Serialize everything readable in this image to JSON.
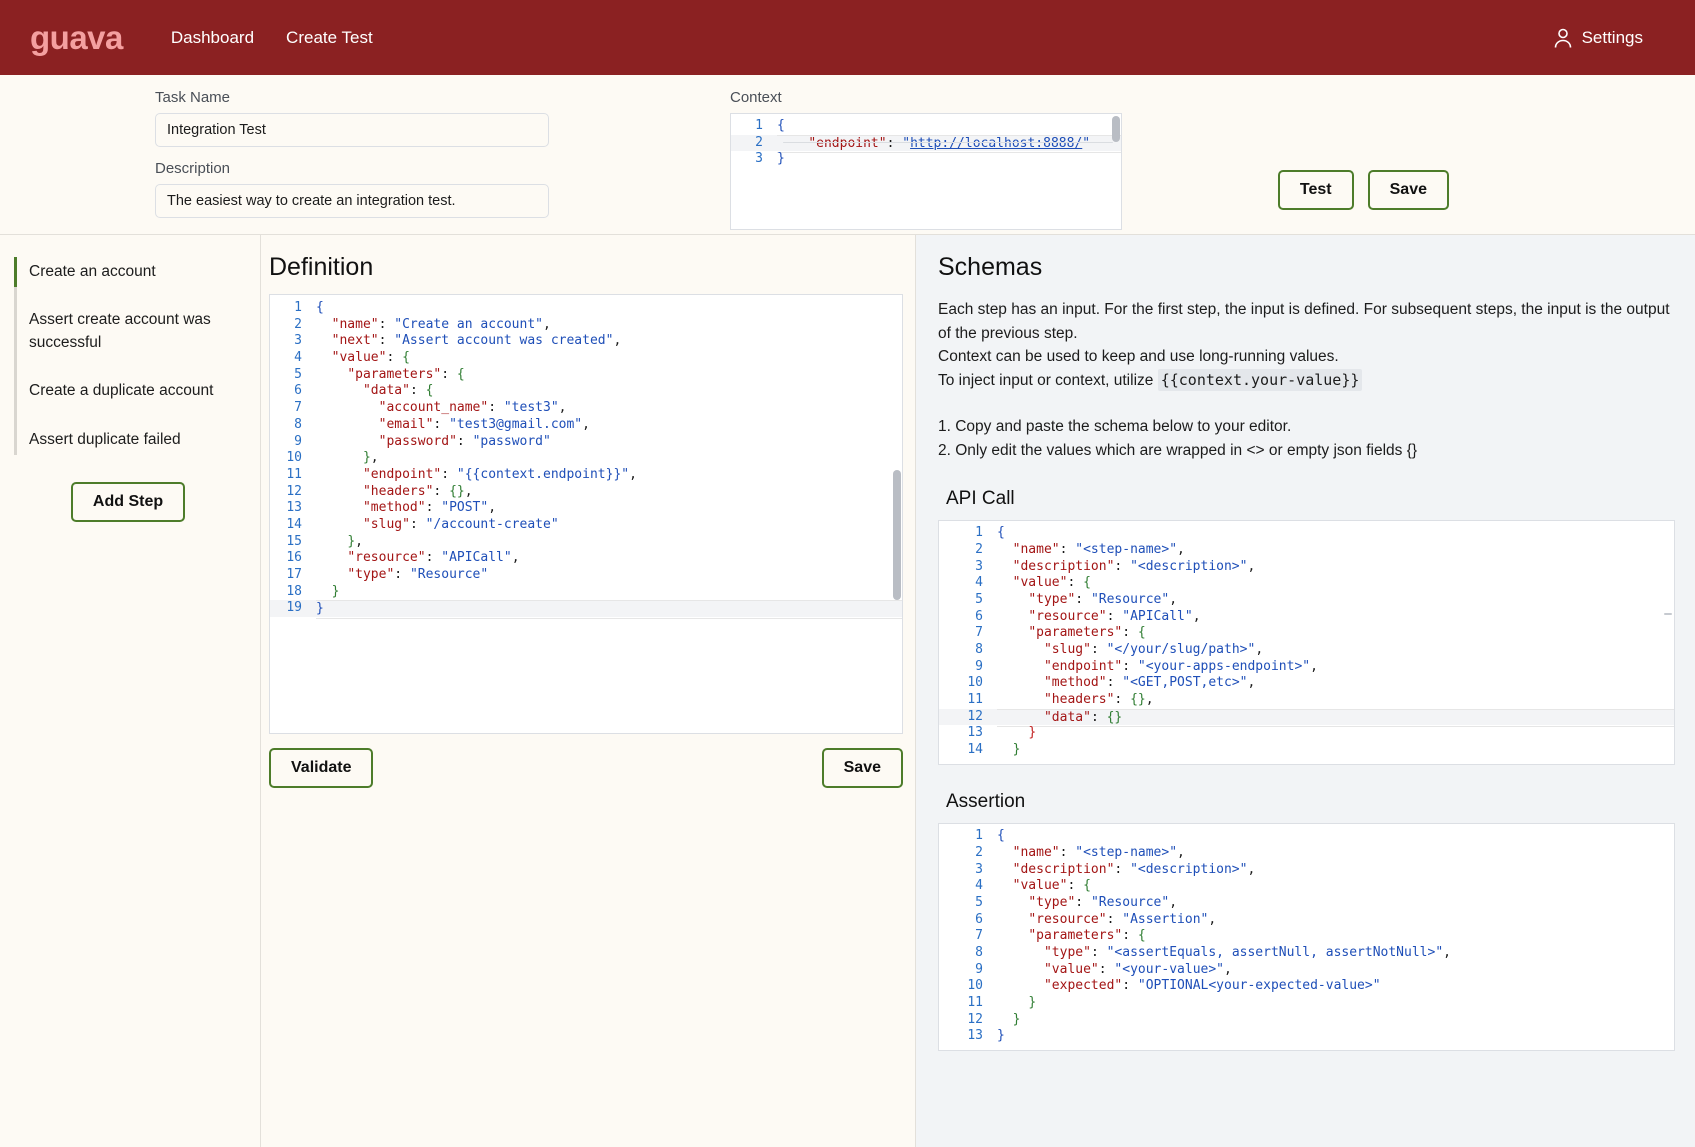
{
  "header": {
    "brand": "guava",
    "nav": [
      {
        "label": "Dashboard",
        "name": "nav-dashboard"
      },
      {
        "label": "Create Test",
        "name": "nav-create-test"
      }
    ],
    "settings_label": "Settings",
    "settings_icon": "person-icon",
    "bg_color": "#8b2122",
    "brand_color": "#f4a0a0"
  },
  "form": {
    "task_name_label": "Task Name",
    "task_name_value": "Integration Test",
    "task_name_placeholder": "Task Name",
    "description_label": "Description",
    "description_value": "The easiest way to create an integration test.",
    "description_placeholder": "Description",
    "context_label": "Context",
    "test_button": "Test",
    "save_button": "Save",
    "button_border_color": "#4d7c2a"
  },
  "context_editor": {
    "lines": [
      {
        "n": "1",
        "tokens": [
          {
            "t": "{",
            "c": "br"
          }
        ]
      },
      {
        "n": "2",
        "active": true,
        "tokens": [
          {
            "t": "    ",
            "c": "p"
          },
          {
            "t": "\"endpoint\"",
            "c": "k"
          },
          {
            "t": ": ",
            "c": "p"
          },
          {
            "t": "\"",
            "c": "s"
          },
          {
            "t": "http://localhost:8888/",
            "c": "url"
          },
          {
            "t": "\"",
            "c": "s"
          }
        ]
      },
      {
        "n": "3",
        "tokens": [
          {
            "t": "}",
            "c": "br"
          }
        ]
      }
    ]
  },
  "steps": {
    "items": [
      {
        "label": "Create an account",
        "active": true
      },
      {
        "label": "Assert create account was successful",
        "active": false
      },
      {
        "label": "Create a duplicate account",
        "active": false
      },
      {
        "label": "Assert duplicate failed",
        "active": false
      }
    ],
    "add_step_label": "Add Step"
  },
  "definition": {
    "title": "Definition",
    "validate_label": "Validate",
    "save_label": "Save",
    "lines": [
      {
        "n": "1",
        "tokens": [
          {
            "t": "{",
            "c": "br"
          }
        ]
      },
      {
        "n": "2",
        "tokens": [
          {
            "t": "  ",
            "c": "p"
          },
          {
            "t": "\"name\"",
            "c": "k"
          },
          {
            "t": ": ",
            "c": "p"
          },
          {
            "t": "\"Create an account\"",
            "c": "s"
          },
          {
            "t": ",",
            "c": "p"
          }
        ]
      },
      {
        "n": "3",
        "tokens": [
          {
            "t": "  ",
            "c": "p"
          },
          {
            "t": "\"next\"",
            "c": "k"
          },
          {
            "t": ": ",
            "c": "p"
          },
          {
            "t": "\"Assert account was created\"",
            "c": "s"
          },
          {
            "t": ",",
            "c": "p"
          }
        ]
      },
      {
        "n": "4",
        "tokens": [
          {
            "t": "  ",
            "c": "p"
          },
          {
            "t": "\"value\"",
            "c": "k"
          },
          {
            "t": ": ",
            "c": "p"
          },
          {
            "t": "{",
            "c": "b"
          }
        ]
      },
      {
        "n": "5",
        "tokens": [
          {
            "t": "    ",
            "c": "p"
          },
          {
            "t": "\"parameters\"",
            "c": "k"
          },
          {
            "t": ": ",
            "c": "p"
          },
          {
            "t": "{",
            "c": "b"
          }
        ]
      },
      {
        "n": "6",
        "tokens": [
          {
            "t": "      ",
            "c": "p"
          },
          {
            "t": "\"data\"",
            "c": "k"
          },
          {
            "t": ": ",
            "c": "p"
          },
          {
            "t": "{",
            "c": "b"
          }
        ]
      },
      {
        "n": "7",
        "tokens": [
          {
            "t": "        ",
            "c": "p"
          },
          {
            "t": "\"account_name\"",
            "c": "k"
          },
          {
            "t": ": ",
            "c": "p"
          },
          {
            "t": "\"test3\"",
            "c": "s"
          },
          {
            "t": ",",
            "c": "p"
          }
        ]
      },
      {
        "n": "8",
        "tokens": [
          {
            "t": "        ",
            "c": "p"
          },
          {
            "t": "\"email\"",
            "c": "k"
          },
          {
            "t": ": ",
            "c": "p"
          },
          {
            "t": "\"test3@gmail.com\"",
            "c": "s"
          },
          {
            "t": ",",
            "c": "p"
          }
        ]
      },
      {
        "n": "9",
        "tokens": [
          {
            "t": "        ",
            "c": "p"
          },
          {
            "t": "\"password\"",
            "c": "k"
          },
          {
            "t": ": ",
            "c": "p"
          },
          {
            "t": "\"password\"",
            "c": "s"
          }
        ]
      },
      {
        "n": "10",
        "tokens": [
          {
            "t": "      ",
            "c": "p"
          },
          {
            "t": "}",
            "c": "b"
          },
          {
            "t": ",",
            "c": "p"
          }
        ]
      },
      {
        "n": "11",
        "tokens": [
          {
            "t": "      ",
            "c": "p"
          },
          {
            "t": "\"endpoint\"",
            "c": "k"
          },
          {
            "t": ": ",
            "c": "p"
          },
          {
            "t": "\"{{context.endpoint}}\"",
            "c": "s"
          },
          {
            "t": ",",
            "c": "p"
          }
        ]
      },
      {
        "n": "12",
        "tokens": [
          {
            "t": "      ",
            "c": "p"
          },
          {
            "t": "\"headers\"",
            "c": "k"
          },
          {
            "t": ": ",
            "c": "p"
          },
          {
            "t": "{}",
            "c": "b"
          },
          {
            "t": ",",
            "c": "p"
          }
        ]
      },
      {
        "n": "13",
        "tokens": [
          {
            "t": "      ",
            "c": "p"
          },
          {
            "t": "\"method\"",
            "c": "k"
          },
          {
            "t": ": ",
            "c": "p"
          },
          {
            "t": "\"POST\"",
            "c": "s"
          },
          {
            "t": ",",
            "c": "p"
          }
        ]
      },
      {
        "n": "14",
        "tokens": [
          {
            "t": "      ",
            "c": "p"
          },
          {
            "t": "\"slug\"",
            "c": "k"
          },
          {
            "t": ": ",
            "c": "p"
          },
          {
            "t": "\"/account-create\"",
            "c": "s"
          }
        ]
      },
      {
        "n": "15",
        "tokens": [
          {
            "t": "    ",
            "c": "p"
          },
          {
            "t": "}",
            "c": "b"
          },
          {
            "t": ",",
            "c": "p"
          }
        ]
      },
      {
        "n": "16",
        "tokens": [
          {
            "t": "    ",
            "c": "p"
          },
          {
            "t": "\"resource\"",
            "c": "k"
          },
          {
            "t": ": ",
            "c": "p"
          },
          {
            "t": "\"APICall\"",
            "c": "s"
          },
          {
            "t": ",",
            "c": "p"
          }
        ]
      },
      {
        "n": "17",
        "tokens": [
          {
            "t": "    ",
            "c": "p"
          },
          {
            "t": "\"type\"",
            "c": "k"
          },
          {
            "t": ": ",
            "c": "p"
          },
          {
            "t": "\"Resource\"",
            "c": "s"
          }
        ]
      },
      {
        "n": "18",
        "tokens": [
          {
            "t": "  ",
            "c": "p"
          },
          {
            "t": "}",
            "c": "b"
          }
        ]
      },
      {
        "n": "19",
        "active": true,
        "tokens": [
          {
            "t": "}",
            "c": "br"
          }
        ]
      }
    ]
  },
  "schemas": {
    "title": "Schemas",
    "para_1": "Each step has an input. For the first step, the input is defined. For subsequent steps, the input is the output of the previous step.",
    "para_2": "Context can be used to keep and use long-running values.",
    "para_3_prefix": "To inject input or context, utilize ",
    "para_3_code": "{{context.your-value}}",
    "list_1": "1. Copy and paste the schema below to your editor.",
    "list_2": "2. Only edit the values which are wrapped in <> or empty json fields {}",
    "api_call_title": "API Call",
    "assertion_title": "Assertion",
    "api_call_lines": [
      {
        "n": "1",
        "tokens": [
          {
            "t": "{",
            "c": "br"
          }
        ]
      },
      {
        "n": "2",
        "tokens": [
          {
            "t": "  ",
            "c": "p"
          },
          {
            "t": "\"name\"",
            "c": "k"
          },
          {
            "t": ": ",
            "c": "p"
          },
          {
            "t": "\"<step-name>\"",
            "c": "s"
          },
          {
            "t": ",",
            "c": "p"
          }
        ]
      },
      {
        "n": "3",
        "tokens": [
          {
            "t": "  ",
            "c": "p"
          },
          {
            "t": "\"description\"",
            "c": "k"
          },
          {
            "t": ": ",
            "c": "p"
          },
          {
            "t": "\"<description>\"",
            "c": "s"
          },
          {
            "t": ",",
            "c": "p"
          }
        ]
      },
      {
        "n": "4",
        "tokens": [
          {
            "t": "  ",
            "c": "p"
          },
          {
            "t": "\"value\"",
            "c": "k"
          },
          {
            "t": ": ",
            "c": "p"
          },
          {
            "t": "{",
            "c": "b"
          }
        ]
      },
      {
        "n": "5",
        "tokens": [
          {
            "t": "    ",
            "c": "p"
          },
          {
            "t": "\"type\"",
            "c": "k"
          },
          {
            "t": ": ",
            "c": "p"
          },
          {
            "t": "\"Resource\"",
            "c": "s"
          },
          {
            "t": ",",
            "c": "p"
          }
        ]
      },
      {
        "n": "6",
        "tokens": [
          {
            "t": "    ",
            "c": "p"
          },
          {
            "t": "\"resource\"",
            "c": "k"
          },
          {
            "t": ": ",
            "c": "p"
          },
          {
            "t": "\"APICall\"",
            "c": "s"
          },
          {
            "t": ",",
            "c": "p"
          }
        ]
      },
      {
        "n": "7",
        "tokens": [
          {
            "t": "    ",
            "c": "p"
          },
          {
            "t": "\"parameters\"",
            "c": "k"
          },
          {
            "t": ": ",
            "c": "p"
          },
          {
            "t": "{",
            "c": "b"
          }
        ]
      },
      {
        "n": "8",
        "tokens": [
          {
            "t": "      ",
            "c": "p"
          },
          {
            "t": "\"slug\"",
            "c": "k"
          },
          {
            "t": ": ",
            "c": "p"
          },
          {
            "t": "\"</your/slug/path>\"",
            "c": "s"
          },
          {
            "t": ",",
            "c": "p"
          }
        ]
      },
      {
        "n": "9",
        "tokens": [
          {
            "t": "      ",
            "c": "p"
          },
          {
            "t": "\"endpoint\"",
            "c": "k"
          },
          {
            "t": ": ",
            "c": "p"
          },
          {
            "t": "\"<your-apps-endpoint>\"",
            "c": "s"
          },
          {
            "t": ",",
            "c": "p"
          }
        ]
      },
      {
        "n": "10",
        "tokens": [
          {
            "t": "      ",
            "c": "p"
          },
          {
            "t": "\"method\"",
            "c": "k"
          },
          {
            "t": ": ",
            "c": "p"
          },
          {
            "t": "\"<GET,POST,etc>\"",
            "c": "s"
          },
          {
            "t": ",",
            "c": "p"
          }
        ]
      },
      {
        "n": "11",
        "tokens": [
          {
            "t": "      ",
            "c": "p"
          },
          {
            "t": "\"headers\"",
            "c": "k"
          },
          {
            "t": ": ",
            "c": "p"
          },
          {
            "t": "{}",
            "c": "b"
          },
          {
            "t": ",",
            "c": "p"
          }
        ]
      },
      {
        "n": "12",
        "active": true,
        "tokens": [
          {
            "t": "      ",
            "c": "p"
          },
          {
            "t": "\"data\"",
            "c": "k"
          },
          {
            "t": ": ",
            "c": "p"
          },
          {
            "t": "{}",
            "c": "b"
          }
        ]
      },
      {
        "n": "13",
        "tokens": [
          {
            "t": "    ",
            "c": "p"
          },
          {
            "t": "}",
            "c": "bad"
          }
        ]
      },
      {
        "n": "14",
        "tokens": [
          {
            "t": "  ",
            "c": "p"
          },
          {
            "t": "}",
            "c": "b"
          }
        ]
      }
    ],
    "assertion_lines": [
      {
        "n": "1",
        "tokens": [
          {
            "t": "{",
            "c": "br"
          }
        ]
      },
      {
        "n": "2",
        "tokens": [
          {
            "t": "  ",
            "c": "p"
          },
          {
            "t": "\"name\"",
            "c": "k"
          },
          {
            "t": ": ",
            "c": "p"
          },
          {
            "t": "\"<step-name>\"",
            "c": "s"
          },
          {
            "t": ",",
            "c": "p"
          }
        ]
      },
      {
        "n": "3",
        "tokens": [
          {
            "t": "  ",
            "c": "p"
          },
          {
            "t": "\"description\"",
            "c": "k"
          },
          {
            "t": ": ",
            "c": "p"
          },
          {
            "t": "\"<description>\"",
            "c": "s"
          },
          {
            "t": ",",
            "c": "p"
          }
        ]
      },
      {
        "n": "4",
        "tokens": [
          {
            "t": "  ",
            "c": "p"
          },
          {
            "t": "\"value\"",
            "c": "k"
          },
          {
            "t": ": ",
            "c": "p"
          },
          {
            "t": "{",
            "c": "b"
          }
        ]
      },
      {
        "n": "5",
        "tokens": [
          {
            "t": "    ",
            "c": "p"
          },
          {
            "t": "\"type\"",
            "c": "k"
          },
          {
            "t": ": ",
            "c": "p"
          },
          {
            "t": "\"Resource\"",
            "c": "s"
          },
          {
            "t": ",",
            "c": "p"
          }
        ]
      },
      {
        "n": "6",
        "tokens": [
          {
            "t": "    ",
            "c": "p"
          },
          {
            "t": "\"resource\"",
            "c": "k"
          },
          {
            "t": ": ",
            "c": "p"
          },
          {
            "t": "\"Assertion\"",
            "c": "s"
          },
          {
            "t": ",",
            "c": "p"
          }
        ]
      },
      {
        "n": "7",
        "tokens": [
          {
            "t": "    ",
            "c": "p"
          },
          {
            "t": "\"parameters\"",
            "c": "k"
          },
          {
            "t": ": ",
            "c": "p"
          },
          {
            "t": "{",
            "c": "b"
          }
        ]
      },
      {
        "n": "8",
        "tokens": [
          {
            "t": "      ",
            "c": "p"
          },
          {
            "t": "\"type\"",
            "c": "k"
          },
          {
            "t": ": ",
            "c": "p"
          },
          {
            "t": "\"<assertEquals, assertNull, assertNotNull>\"",
            "c": "s"
          },
          {
            "t": ",",
            "c": "p"
          }
        ]
      },
      {
        "n": "9",
        "tokens": [
          {
            "t": "      ",
            "c": "p"
          },
          {
            "t": "\"value\"",
            "c": "k"
          },
          {
            "t": ": ",
            "c": "p"
          },
          {
            "t": "\"<your-value>\"",
            "c": "s"
          },
          {
            "t": ",",
            "c": "p"
          }
        ]
      },
      {
        "n": "10",
        "tokens": [
          {
            "t": "      ",
            "c": "p"
          },
          {
            "t": "\"expected\"",
            "c": "k"
          },
          {
            "t": ": ",
            "c": "p"
          },
          {
            "t": "\"OPTIONAL<your-expected-value>\"",
            "c": "s"
          }
        ]
      },
      {
        "n": "11",
        "tokens": [
          {
            "t": "    ",
            "c": "p"
          },
          {
            "t": "}",
            "c": "b"
          }
        ]
      },
      {
        "n": "12",
        "tokens": [
          {
            "t": "  ",
            "c": "p"
          },
          {
            "t": "}",
            "c": "b"
          }
        ]
      },
      {
        "n": "13",
        "tokens": [
          {
            "t": "}",
            "c": "br"
          }
        ]
      }
    ]
  }
}
